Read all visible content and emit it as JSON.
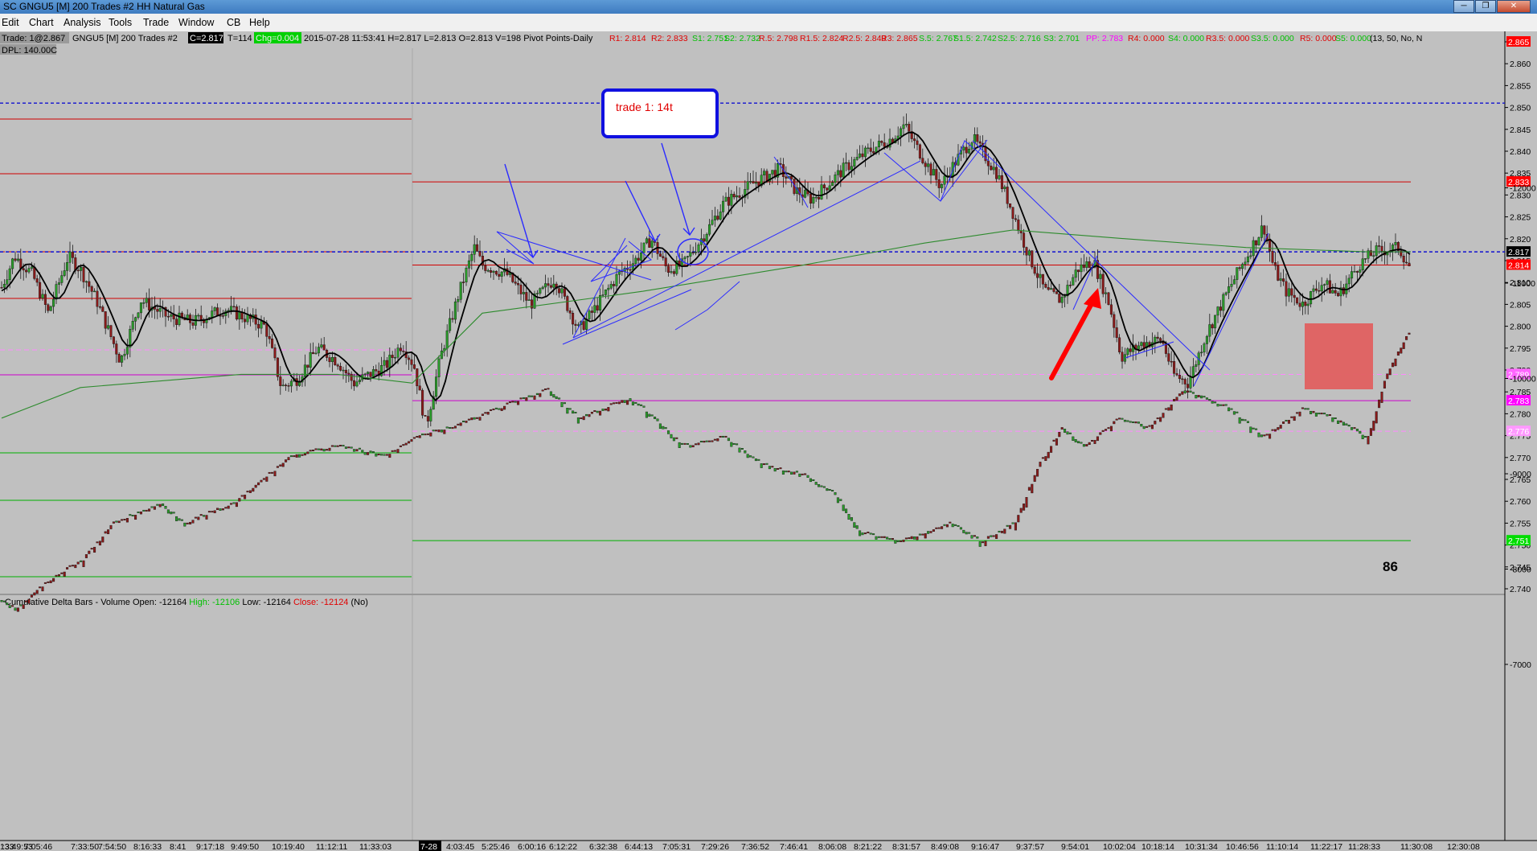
{
  "window": {
    "title": "SC GNGU5 [M]  200 Trades  #2  HH Natural Gas",
    "buttons": [
      "─",
      "❐",
      "✕"
    ]
  },
  "menu": [
    "Edit",
    "Chart",
    "Analysis",
    "Tools",
    "Trade",
    "Window",
    "CB",
    "Help"
  ],
  "infobar": {
    "trade": "Trade: 1@2.867",
    "symbol": "GNGU5 [M]  200 Trades  #2",
    "close": "C=2.817",
    "t": "T=114",
    "chg": "Chg=0.004",
    "stats": "2015-07-28 11:53:41  H=2.817  L=2.813  O=2.813  V=198  Pivot Points-Daily",
    "dpl": "DPL: 140.00C",
    "pivots": [
      {
        "t": "R1: 2.814",
        "c": "#e00000"
      },
      {
        "t": "R2: 2.833",
        "c": "#e00000"
      },
      {
        "t": "S1: 2.751",
        "c": "#00c000"
      },
      {
        "t": "S2: 2.732",
        "c": "#00c000"
      },
      {
        "t": "R.5: 2.798",
        "c": "#e00000"
      },
      {
        "t": "R1.5: 2.824",
        "c": "#e00000"
      },
      {
        "t": "R2.5: 2.849",
        "c": "#e00000"
      },
      {
        "t": "R3: 2.865",
        "c": "#e00000"
      },
      {
        "t": "S.5: 2.767",
        "c": "#00c000"
      },
      {
        "t": "S1.5: 2.742",
        "c": "#00c000"
      },
      {
        "t": "S2.5: 2.716",
        "c": "#00c000"
      },
      {
        "t": "S3: 2.701",
        "c": "#00c000"
      },
      {
        "t": "PP: 2.783",
        "c": "#ff00ff"
      },
      {
        "t": "R4: 0.000",
        "c": "#e00000"
      },
      {
        "t": "S4: 0.000",
        "c": "#00c000"
      },
      {
        "t": "R3.5: 0.000",
        "c": "#e00000"
      },
      {
        "t": "S3.5: 0.000",
        "c": "#00c000"
      },
      {
        "t": "R5: 0.000",
        "c": "#e00000"
      },
      {
        "t": "S5: 0.000",
        "c": "#00c000"
      },
      {
        "t": "(13, 50, No, N",
        "c": "#000000"
      }
    ]
  },
  "price_axis": [
    "2.865",
    "2.860",
    "2.855",
    "2.850",
    "2.845",
    "2.840",
    "2.835",
    "2.830",
    "2.825",
    "2.820",
    "2.815",
    "2.810",
    "2.805",
    "2.800",
    "2.795",
    "2.790",
    "2.785",
    "2.780",
    "2.775",
    "2.770",
    "2.765",
    "2.760",
    "2.755",
    "2.750",
    "2.745",
    "2.740"
  ],
  "price_tags": [
    {
      "t": "2.865",
      "bg": "#ff0000",
      "fg": "#ffffff",
      "v": 2.865
    },
    {
      "t": "2.833",
      "bg": "#ff0000",
      "fg": "#ffffff",
      "v": 2.833
    },
    {
      "t": "2.817",
      "bg": "#000000",
      "fg": "#ffffff",
      "v": 2.817
    },
    {
      "t": "2.814",
      "bg": "#ff0000",
      "fg": "#ffffff",
      "v": 2.814
    },
    {
      "t": "2.789",
      "bg": "#ff66ff",
      "fg": "#ffffff",
      "v": 2.789
    },
    {
      "t": "2.783",
      "bg": "#ff00ff",
      "fg": "#ffffff",
      "v": 2.783
    },
    {
      "t": "2.776",
      "bg": "#ff99ff",
      "fg": "#ffffff",
      "v": 2.776
    },
    {
      "t": "2.751",
      "bg": "#00dd00",
      "fg": "#ffffff",
      "v": 2.751
    }
  ],
  "annotation": {
    "text": "trade 1: 14t",
    "count": "86"
  },
  "lower_panel": {
    "title": "Cumulative Delta Bars - Volume  Open: -12164 ",
    "high": "High: -12106 ",
    "low": " Low: -12164 ",
    "close": " Close: -12124 ",
    "flag": " (No)",
    "axis": [
      "-7000",
      "-8000",
      "-9000",
      "-10000",
      "-11000",
      "-12000"
    ]
  },
  "time_axis": [
    "7:05:46",
    "7:33:50",
    "7:54:50",
    "8:16:33",
    "8:41",
    "9:17:18",
    "9:49:50",
    "10:19:40",
    "11:12:11",
    "11:33:03",
    "7-28",
    "4:03:45",
    "5:25:46",
    "6:00:16",
    "6:12:22",
    "6:32:38",
    "6:44:13",
    "7:05:31",
    "7:29:26",
    "7:36:52",
    "7:46:41",
    "8:06:08",
    "8:21:22",
    "8:31:57",
    "8:49:08",
    "9:16:47",
    "9:37:57",
    "9:54:01",
    "10:02:04",
    "10:18:14",
    "10:31:34",
    "10:46:56",
    "11:10:14",
    "11:22:17",
    "11:28:33",
    "11:30:08",
    "12:30:08",
    "13:49:53"
  ],
  "time_axis_first": ":33",
  "colors": {
    "bg": "#c0c0c0",
    "candle_up": "#2a9d2a",
    "candle_dn": "#8b1a1a",
    "ma_fast": "#000000",
    "ma_slow": "#2e8b2e",
    "trend": "#2b2bff",
    "arrow": "#ff0000"
  }
}
